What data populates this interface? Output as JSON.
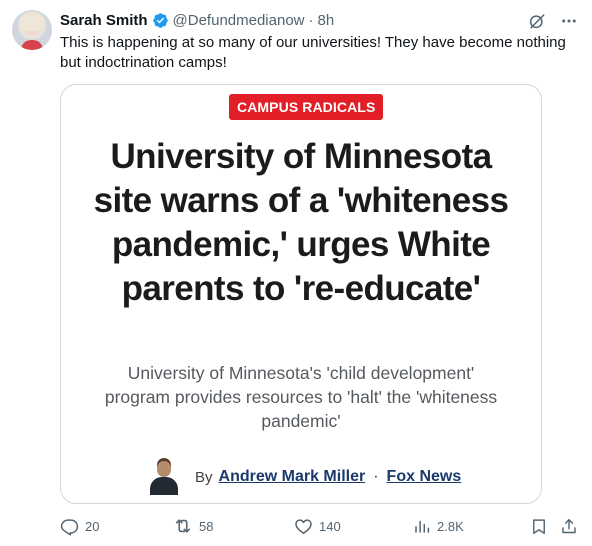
{
  "user": {
    "name": "Sarah Smith",
    "handle": "@Defundmedianow",
    "separator": "·",
    "time": "8h"
  },
  "tweet_text": "This is happening at so many of our universities! They have become nothing but indoctrination camps!",
  "card": {
    "badge": "CAMPUS RADICALS",
    "headline": "University of Minnesota site warns of a 'whiteness pandemic,' urges White parents to 're-educate'",
    "subtitle": "University of Minnesota's 'child development' program provides resources to 'halt' the 'whiteness pandemic'",
    "by_label": "By",
    "author": "Andrew Mark Miller",
    "separator": "·",
    "outlet": "Fox News"
  },
  "actions": {
    "replies": "20",
    "reposts": "58",
    "likes": "140",
    "views": "2.8K"
  },
  "colors": {
    "badge": "#e21f26",
    "verified": "#1d9bf0",
    "muted": "#536471",
    "byline": "#1b3a6b"
  },
  "icons": [
    "verified-icon",
    "grok-icon",
    "more-icon",
    "reply-icon",
    "repost-icon",
    "like-icon",
    "views-icon",
    "bookmark-icon",
    "share-icon"
  ]
}
